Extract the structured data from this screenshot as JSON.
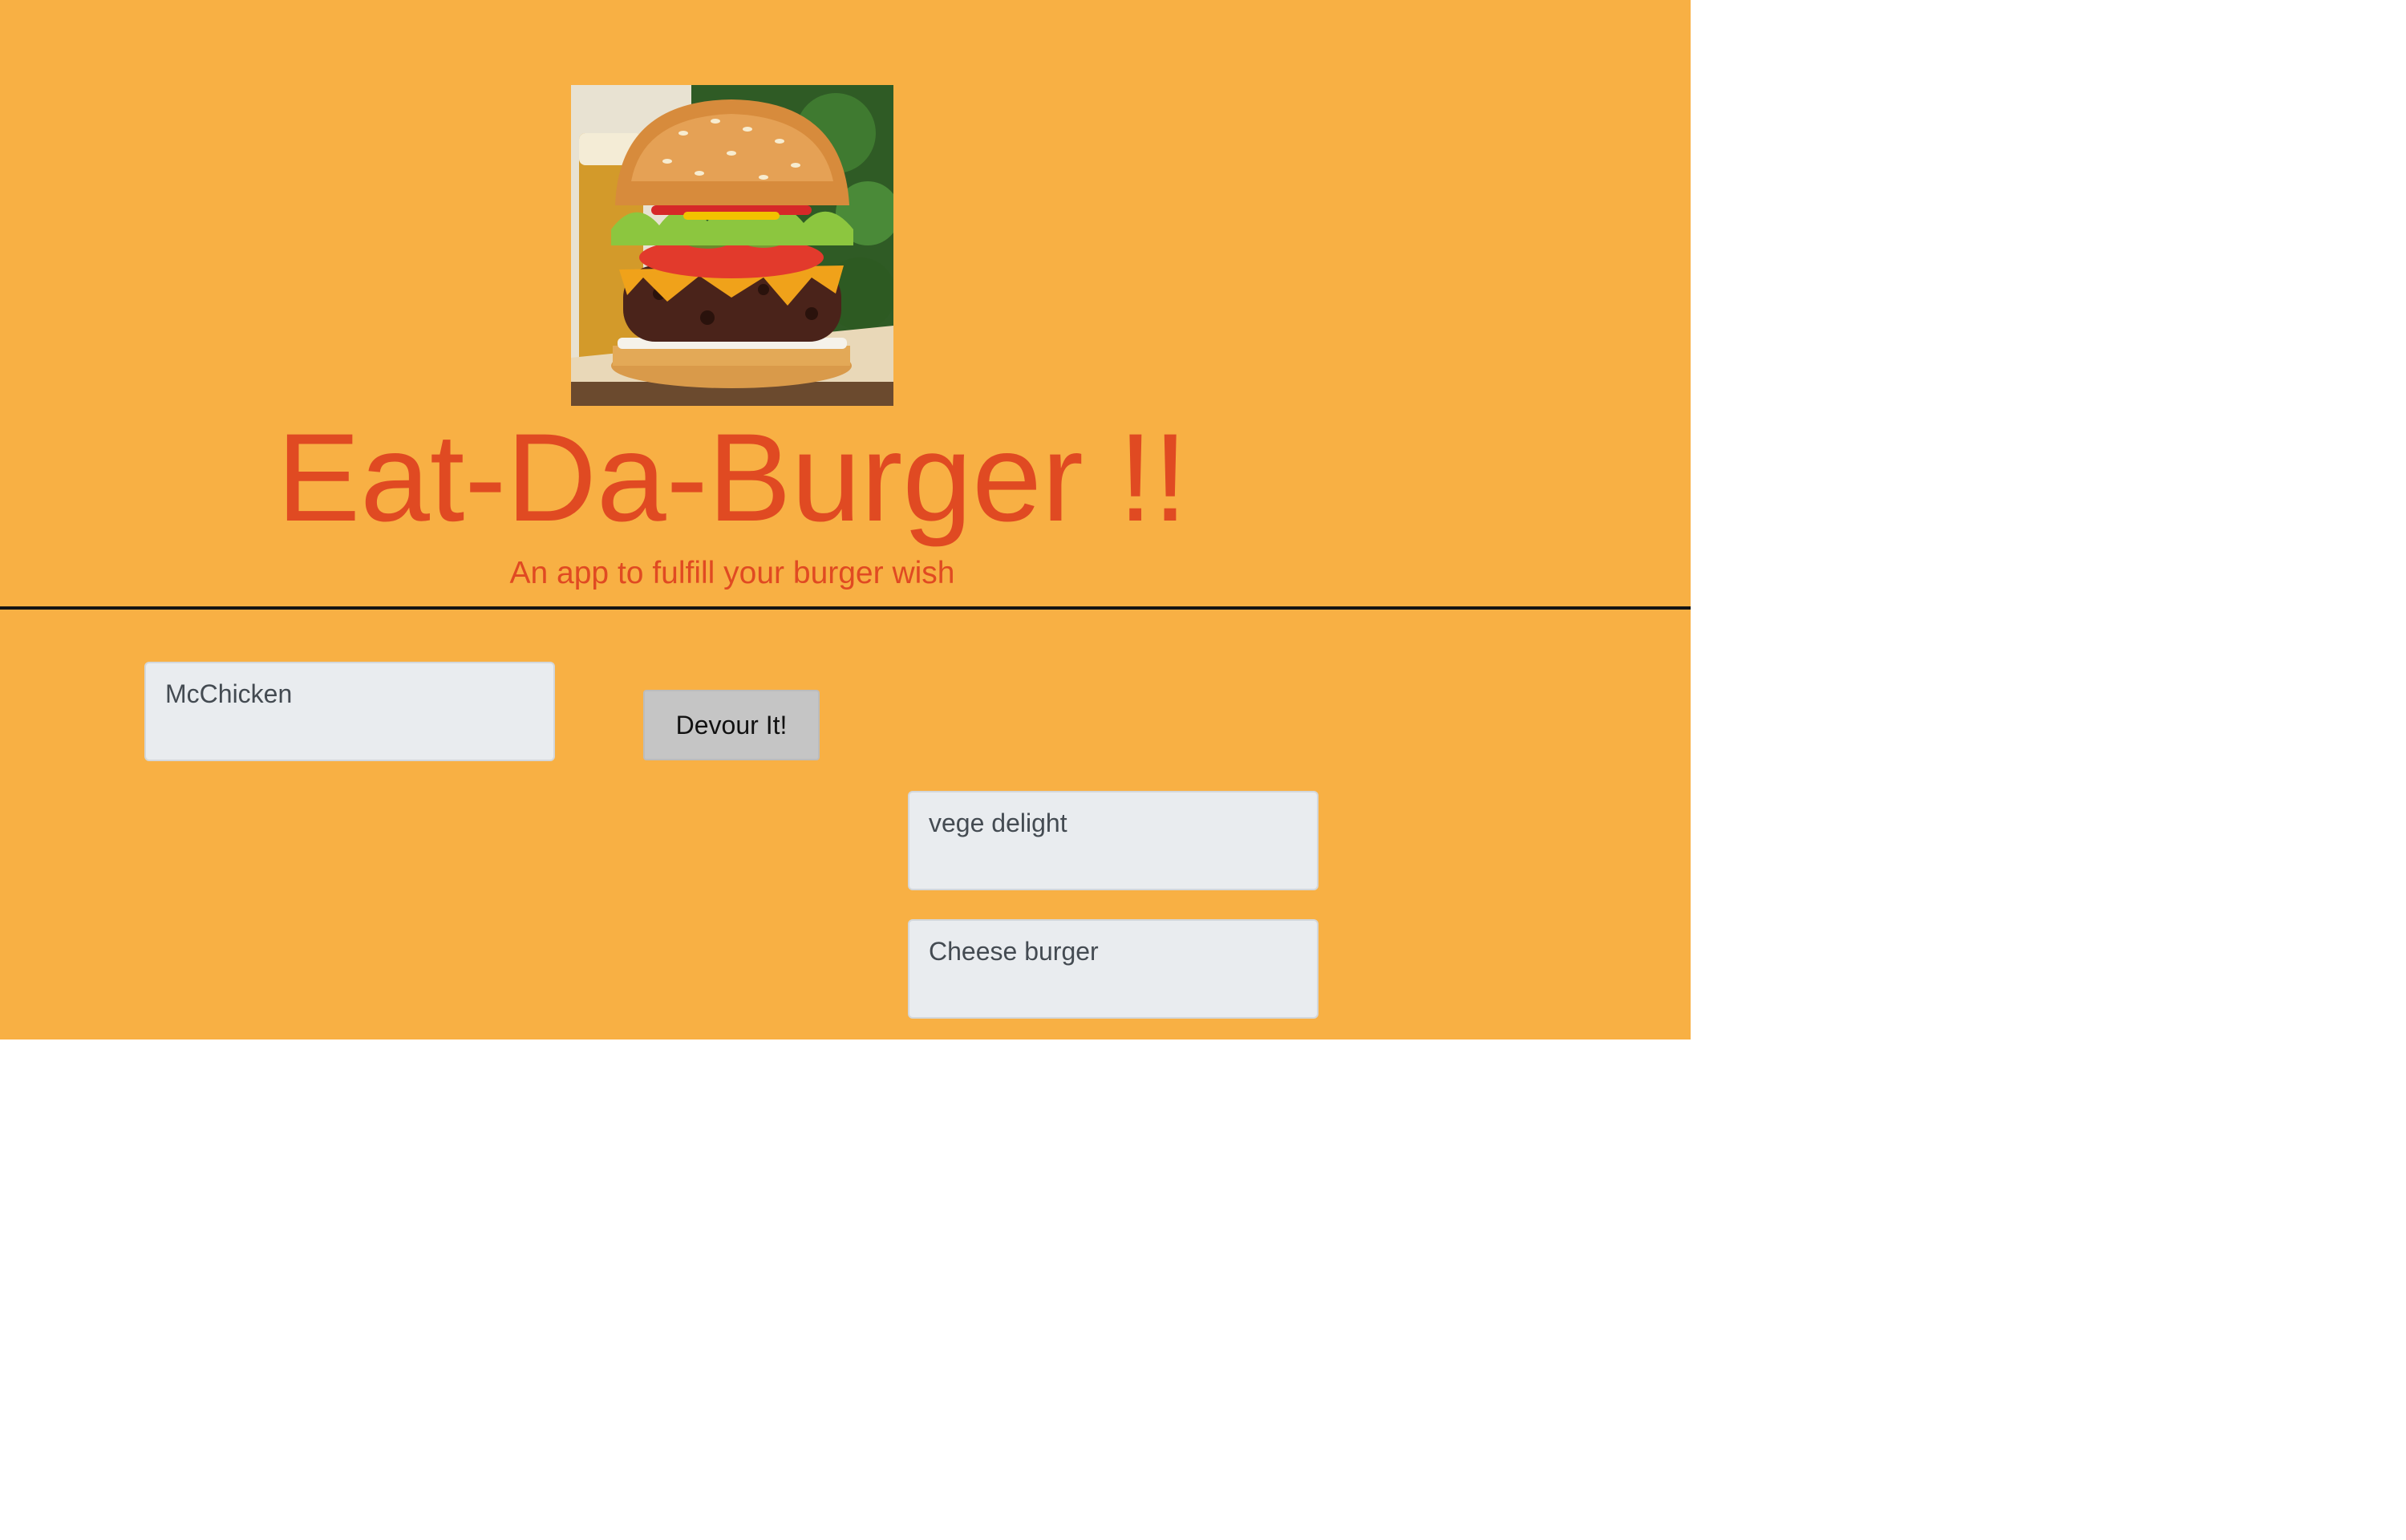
{
  "header": {
    "image_icon": "burger-photo",
    "title": "Eat-Da-Burger !!",
    "subtitle": "An app to fulfill your burger wish"
  },
  "burgers": {
    "not_devoured": [
      {
        "name": "McChicken",
        "button_label": "Devour It!"
      }
    ],
    "devoured": [
      {
        "name": "vege delight"
      },
      {
        "name": "Cheese burger"
      }
    ]
  },
  "colors": {
    "page_background": "#f8b044",
    "title_color": "#e04a22",
    "card_background": "#e9ecef",
    "button_background": "#c5c5c5",
    "divider": "#141414"
  }
}
